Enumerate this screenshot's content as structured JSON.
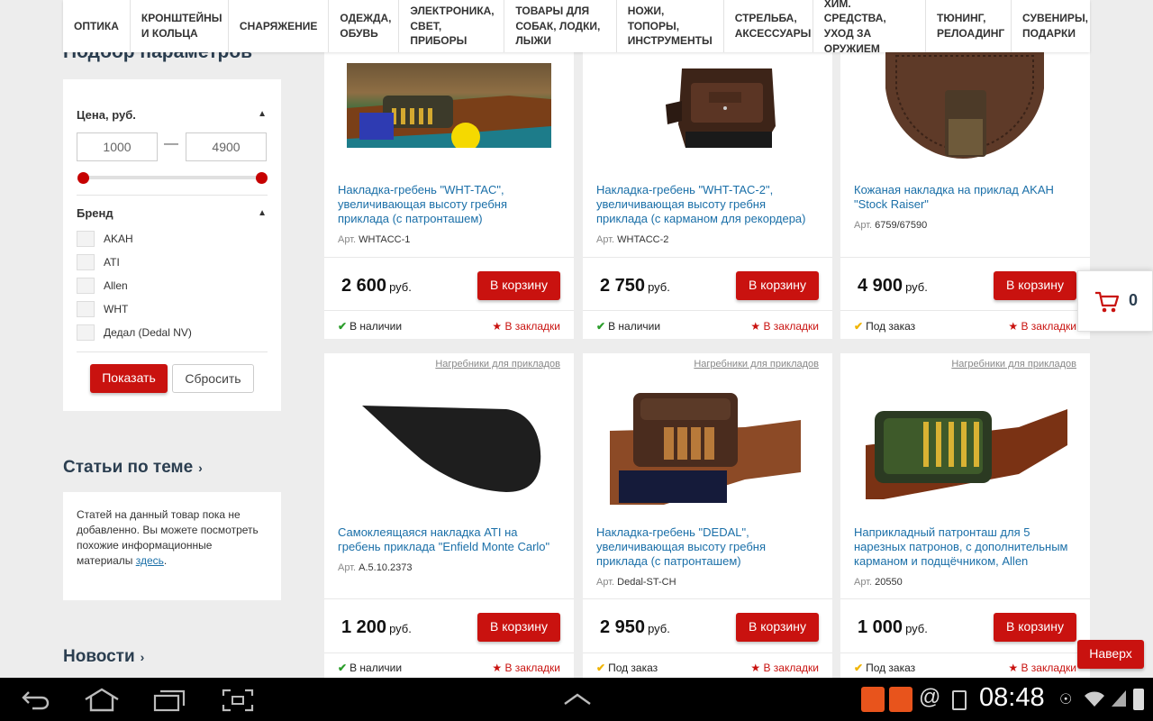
{
  "nav": {
    "items": [
      "ОПТИКА",
      "КРОНШТЕЙНЫ И КОЛЬЦА",
      "СНАРЯЖЕНИЕ",
      "ОДЕЖДА, ОБУВЬ",
      "ЭЛЕКТРОНИКА, СВЕТ, ПРИБОРЫ",
      "ТОВАРЫ ДЛЯ СОБАК, ЛОДКИ, ЛЫЖИ",
      "НОЖИ, ТОПОРЫ, ИНСТРУМЕНТЫ",
      "СТРЕЛЬБА, АКСЕССУАРЫ",
      "ХИМ. СРЕДСТВА, УХОД ЗА ОРУЖИЕМ",
      "ТЮНИНГ, РЕЛОАДИНГ",
      "СУВЕНИРЫ, ПОДАРКИ"
    ]
  },
  "filter": {
    "title": "Подбор параметров",
    "price_label": "Цена, руб.",
    "price_min": "1000",
    "price_max": "4900",
    "range_dash": "—",
    "brand_label": "Бренд",
    "brands": [
      "AKAH",
      "ATI",
      "Allen",
      "WHT",
      "Дедал (Dedal NV)"
    ],
    "show_button": "Показать",
    "reset_button": "Сбросить"
  },
  "articles": {
    "title": "Статьи по теме",
    "text": "Статей на данный товар пока не добавленно. Вы можете посмотреть похожие информационные материалы",
    "link": "здесь",
    "period": "."
  },
  "news": {
    "title": "Новости"
  },
  "products": [
    {
      "category": "",
      "name": "Накладка-гребень \"WHT-TAC\", увеличивающая высоту гребня приклада (с патронташем)",
      "art_label": "Арт.",
      "art": "WHTACC-1",
      "price": "2 600",
      "currency": "руб.",
      "buy": "В корзину",
      "availability": "В наличии",
      "avail_status": "in-stock",
      "favorite": "В закладки"
    },
    {
      "category": "",
      "name": "Накладка-гребень \"WHT-TAC-2\", увеличивающая высоту гребня приклада (с карманом для рекордера)",
      "art_label": "Арт.",
      "art": "WHTACC-2",
      "price": "2 750",
      "currency": "руб.",
      "buy": "В корзину",
      "availability": "В наличии",
      "avail_status": "in-stock",
      "favorite": "В закладки"
    },
    {
      "category": "",
      "name": "Кожаная накладка на приклад AKAH \"Stock Raiser\"",
      "art_label": "Арт.",
      "art": "6759/67590",
      "price": "4 900",
      "currency": "руб.",
      "buy": "В корзину",
      "availability": "Под заказ",
      "avail_status": "on-order",
      "favorite": "В закладки"
    },
    {
      "category": "Нагребники для прикладов",
      "name": "Самоклеящаяся накладка ATI на гребень приклада \"Enfield Monte Carlo\"",
      "art_label": "Арт.",
      "art": "A.5.10.2373",
      "price": "1 200",
      "currency": "руб.",
      "buy": "В корзину",
      "availability": "В наличии",
      "avail_status": "in-stock",
      "favorite": "В закладки"
    },
    {
      "category": "Нагребники для прикладов",
      "name": "Накладка-гребень \"DEDAL\", увеличивающая высоту гребня приклада (с патронташем)",
      "art_label": "Арт.",
      "art": "Dedal-ST-CH",
      "price": "2 950",
      "currency": "руб.",
      "buy": "В корзину",
      "availability": "Под заказ",
      "avail_status": "on-order",
      "favorite": "В закладки"
    },
    {
      "category": "Нагребники для прикладов",
      "name": "Наприкладный патронташ для 5 нарезных патронов, с дополнительным карманом и подщёчником, Allen",
      "art_label": "Арт.",
      "art": "20550",
      "price": "1 000",
      "currency": "руб.",
      "buy": "В корзину",
      "availability": "Под заказ",
      "avail_status": "on-order",
      "favorite": "В закладки"
    }
  ],
  "cart": {
    "count": "0"
  },
  "to_top": "Наверх",
  "status_bar": {
    "time": "08:48"
  },
  "colors": {
    "accent": "#c9120f",
    "link": "#1a6fa8",
    "in_stock": "#2a9d2a",
    "on_order": "#f0b400"
  }
}
